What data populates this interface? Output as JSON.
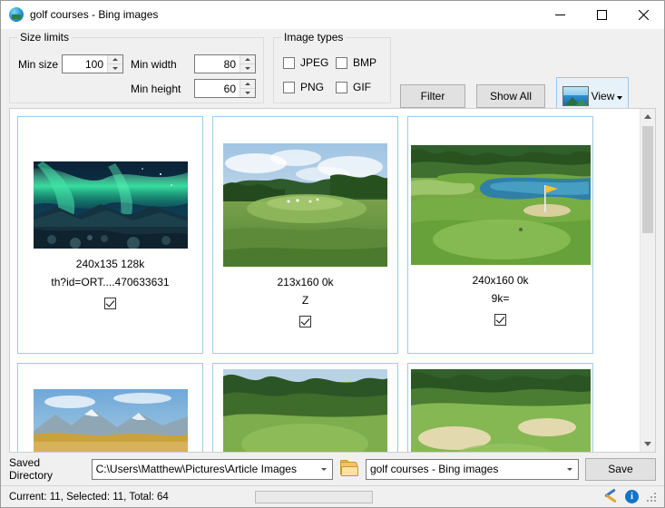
{
  "window": {
    "title": "golf courses - Bing images",
    "icon": "app-globe-icon",
    "minimize": "—",
    "maximize": "☐",
    "close": "✕"
  },
  "size_limits": {
    "legend": "Size limits",
    "min_size_label": "Min size",
    "min_size_value": "100",
    "min_width_label": "Min width",
    "min_width_value": "80",
    "min_height_label": "Min height",
    "min_height_value": "60"
  },
  "image_types": {
    "legend": "Image types",
    "options": [
      {
        "label": "JPEG",
        "checked": false
      },
      {
        "label": "BMP",
        "checked": false
      },
      {
        "label": "PNG",
        "checked": false
      },
      {
        "label": "GIF",
        "checked": false
      }
    ]
  },
  "toolbar": {
    "filter_label": "Filter",
    "show_all_label": "Show All",
    "view_label": "View"
  },
  "gallery": {
    "cards": [
      {
        "name": "aurora-over-rocky-coast",
        "caption_line1": "240x135 128k",
        "caption_line2": "th?id=ORT....470633631",
        "checked": true,
        "thumb_w": 170,
        "thumb_h": 96
      },
      {
        "name": "golf-fairway-with-trees",
        "caption_line1": "213x160 0k",
        "caption_line2": "Z",
        "checked": true,
        "thumb_w": 181,
        "thumb_h": 136
      },
      {
        "name": "golf-green-with-pond",
        "caption_line1": "240x160 0k",
        "caption_line2": "9k=",
        "checked": true,
        "thumb_w": 198,
        "thumb_h": 132
      },
      {
        "name": "mountain-lake-autumn",
        "caption_line1": "",
        "caption_line2": "",
        "checked": false,
        "thumb_w": 170,
        "thumb_h": 96
      },
      {
        "name": "fairway-tree-lined",
        "caption_line1": "",
        "caption_line2": "",
        "checked": false,
        "thumb_w": 181,
        "thumb_h": 110
      },
      {
        "name": "golf-course-bunkers",
        "caption_line1": "",
        "caption_line2": "",
        "checked": false,
        "thumb_w": 198,
        "thumb_h": 110
      }
    ]
  },
  "bottom": {
    "saved_directory_label": "Saved Directory",
    "directory_value": "C:\\Users\\Matthew\\Pictures\\Article Images",
    "folder_icon": "folder-icon",
    "collection_value": "golf courses - Bing images",
    "save_label": "Save"
  },
  "status": {
    "text": "Current: 11, Selected: 11, Total: 64",
    "tools_icon": "tools-icon",
    "info_icon": "info-icon"
  }
}
